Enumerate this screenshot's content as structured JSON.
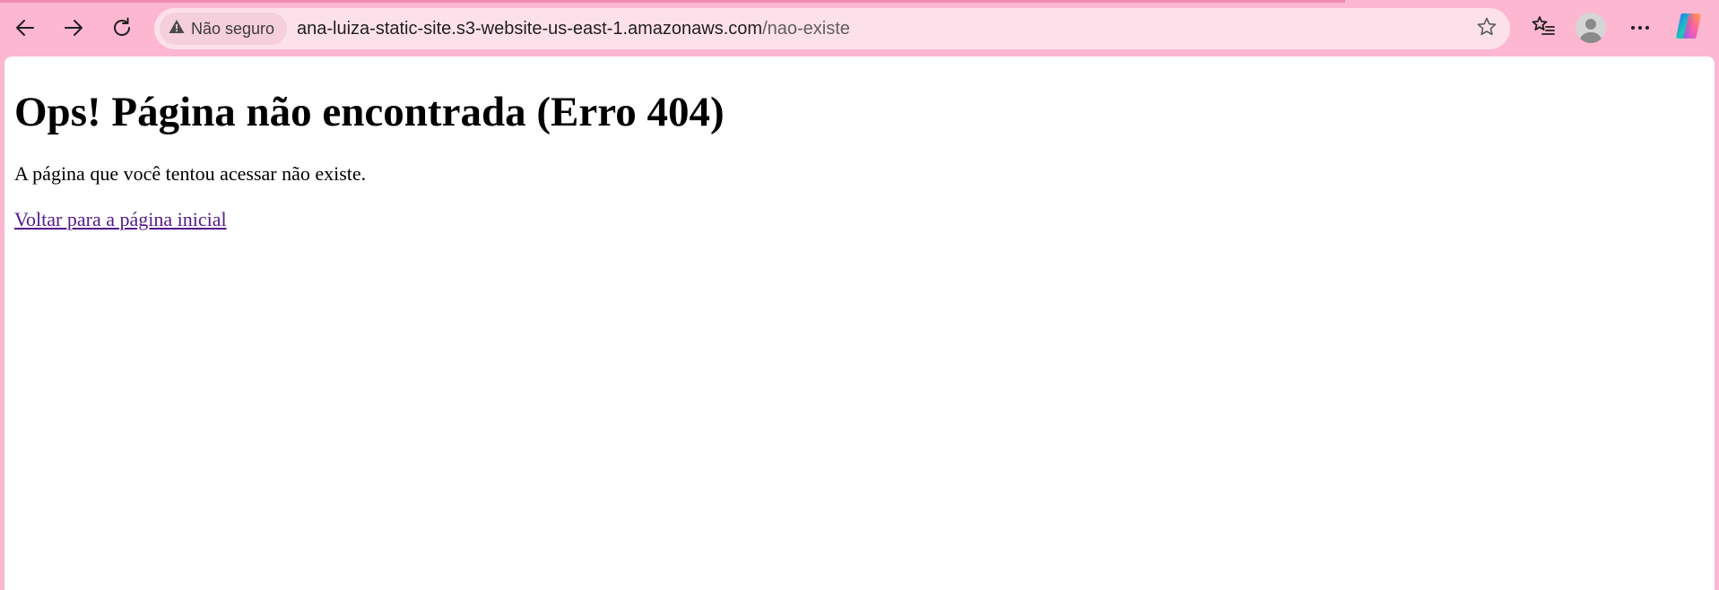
{
  "browser": {
    "accent_color": "#fdb7d0",
    "toolbar": {
      "back_icon": "arrow-left-icon",
      "forward_icon": "arrow-right-icon",
      "reload_icon": "reload-icon",
      "favorites_icon": "favorites-list-icon",
      "profile_icon": "profile-avatar",
      "menu_icon": "more-horizontal-icon",
      "copilot_icon": "copilot-icon"
    },
    "omnibox": {
      "security_label": "Não seguro",
      "security_icon": "warning-triangle-icon",
      "url_host": "ana-luiza-static-site.s3-website-us-east-1.amazonaws.com",
      "url_path": "/nao-existe",
      "star_icon": "star-icon"
    }
  },
  "page": {
    "heading": "Ops! Página não encontrada (Erro 404)",
    "message": "A página que você tentou acessar não existe.",
    "link_text": "Voltar para a página inicial",
    "link_color": "#551a8b"
  }
}
